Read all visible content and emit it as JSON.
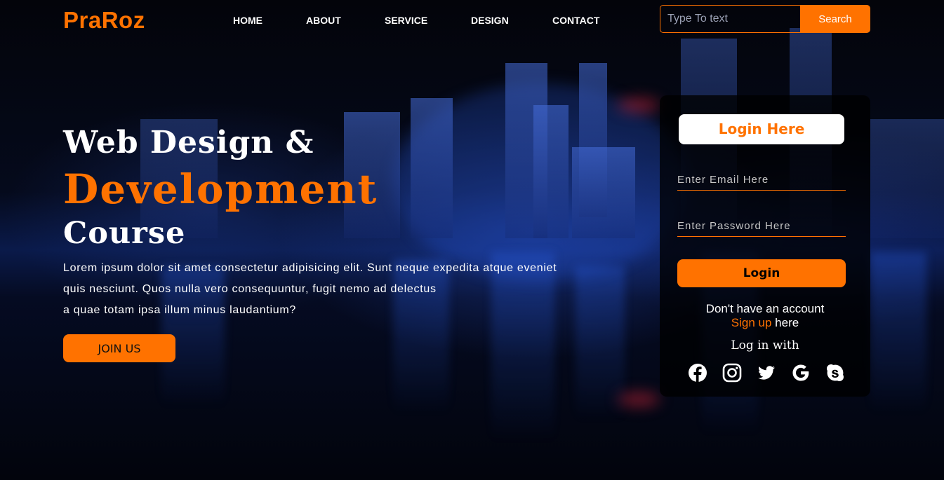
{
  "brand": {
    "name": "PraRoz",
    "accent": "#ff7200"
  },
  "nav": {
    "items": [
      {
        "label": "HOME"
      },
      {
        "label": "ABOUT"
      },
      {
        "label": "SERVICE"
      },
      {
        "label": "DESIGN"
      },
      {
        "label": "CONTACT"
      }
    ]
  },
  "search": {
    "placeholder": "Type To text",
    "value": "",
    "button_label": "Search"
  },
  "hero": {
    "line1": "Web Design &",
    "line2": "Development",
    "line3": "Course",
    "paragraph": [
      "Lorem ipsum dolor sit amet consectetur adipisicing elit. Sunt neque expedita atque eveniet",
      "quis nesciunt. Quos nulla vero consequuntur, fugit nemo ad delectus",
      "a quae totam ipsa illum minus laudantium?"
    ],
    "cta_label": "JOIN US"
  },
  "login": {
    "heading": "Login Here",
    "email_placeholder": "Enter Email Here",
    "password_placeholder": "Enter Password Here",
    "submit_label": "Login",
    "no_account": "Don't have an account",
    "signup_link": "Sign up",
    "signup_suffix": " here",
    "social_heading": "Log in with",
    "socials": [
      {
        "icon": "facebook-icon"
      },
      {
        "icon": "instagram-icon"
      },
      {
        "icon": "twitter-icon"
      },
      {
        "icon": "google-icon"
      },
      {
        "icon": "skype-icon"
      }
    ]
  }
}
